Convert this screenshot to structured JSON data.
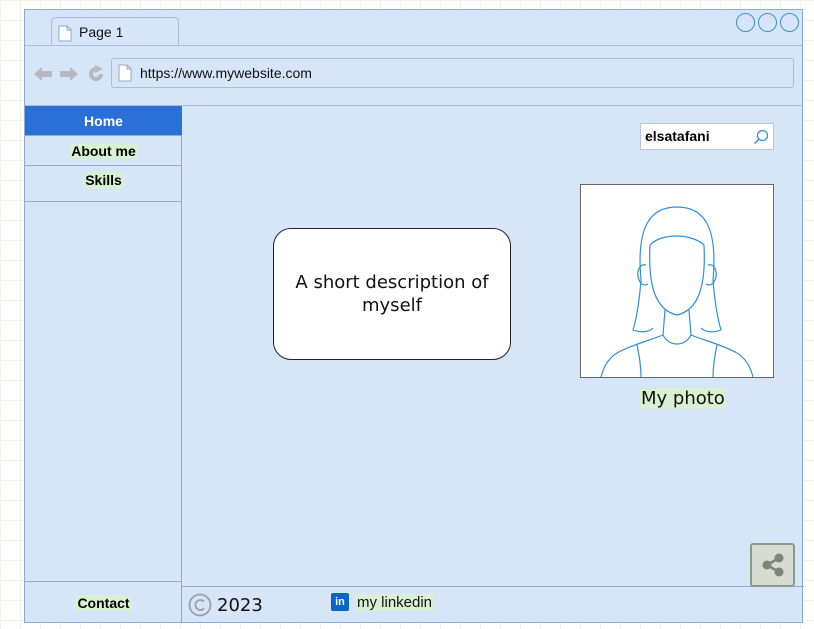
{
  "browser": {
    "tab_label": "Page 1",
    "url": "https://www.mywebsite.com",
    "icons": [
      "back-arrow-icon",
      "forward-arrow-icon",
      "reload-icon",
      "page-icon"
    ]
  },
  "sidebar": {
    "items": [
      {
        "label": "Home",
        "active": true
      },
      {
        "label": "About me",
        "active": false
      },
      {
        "label": "Skills",
        "active": false
      }
    ],
    "contact_label": "Contact"
  },
  "search": {
    "value": "elsatafani",
    "icon": "search-icon"
  },
  "main": {
    "description": "A short description of myself",
    "photo_caption": "My photo"
  },
  "footer": {
    "copyright_year": "2023",
    "linkedin_label": "my linkedin",
    "linkedin_icon_text": "in"
  },
  "colors": {
    "window_bg": "#d6e5f8",
    "active_nav": "#2b6fd9",
    "highlight": "#daf0d3",
    "window_buttons": "#3a8fd8"
  }
}
